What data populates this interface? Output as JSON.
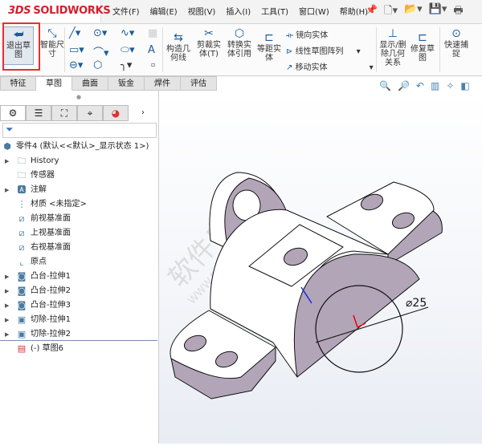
{
  "app": {
    "logo": "SOLIDWORKS",
    "logo_prefix": "3DS"
  },
  "menu": [
    "文件(F)",
    "编辑(E)",
    "视图(V)",
    "插入(I)",
    "工具(T)",
    "窗口(W)",
    "帮助(H)"
  ],
  "quick_access": [
    "new-icon",
    "open-icon",
    "save-icon",
    "print-icon"
  ],
  "ribbon": {
    "exit_sketch": "退出草图",
    "smart_dim": "智能尺寸",
    "construction": "构造几何线",
    "trim": "剪裁实体(T)",
    "convert": "转换实体引用",
    "offset": "等距实体",
    "mirror": "镜向实体",
    "linear_pattern": "线性草图阵列",
    "move": "移动实体",
    "show_relations": "显示/删除几何关系",
    "repair": "修复草图",
    "quick_snap": "快速捕捉"
  },
  "tabs": [
    "特征",
    "草图",
    "曲面",
    "钣金",
    "焊件",
    "评估"
  ],
  "active_tab": "草图",
  "tree": {
    "root": "零件4  (默认<<默认>_显示状态 1>)",
    "items": [
      {
        "label": "History",
        "icon": "history-folder-icon",
        "expand": true
      },
      {
        "label": "传感器",
        "icon": "sensor-folder-icon",
        "expand": false
      },
      {
        "label": "注解",
        "icon": "annotation-folder-icon",
        "expand": true
      },
      {
        "label": "材质 <未指定>",
        "icon": "material-icon",
        "expand": false
      },
      {
        "label": "前视基准面",
        "icon": "plane-icon",
        "expand": false
      },
      {
        "label": "上视基准面",
        "icon": "plane-icon",
        "expand": false
      },
      {
        "label": "右视基准面",
        "icon": "plane-icon",
        "expand": false
      },
      {
        "label": "原点",
        "icon": "origin-icon",
        "expand": false
      },
      {
        "label": "凸台-拉伸1",
        "icon": "boss-extrude-icon",
        "expand": true
      },
      {
        "label": "凸台-拉伸2",
        "icon": "boss-extrude-icon",
        "expand": true
      },
      {
        "label": "凸台-拉伸3",
        "icon": "boss-extrude-icon",
        "expand": true
      },
      {
        "label": "切除-拉伸1",
        "icon": "cut-extrude-icon",
        "expand": true
      },
      {
        "label": "切除-拉伸2",
        "icon": "cut-extrude-icon",
        "expand": true
      }
    ],
    "sketch": "(-) 草图6"
  },
  "viewport": {
    "dimension": "⌀25",
    "watermark": "软件自学网",
    "watermark_url": "WWW.RJZXW.COM"
  },
  "colors": {
    "accent": "#d0202c",
    "highlight": "#e53030",
    "face": "#b3a5b8"
  }
}
